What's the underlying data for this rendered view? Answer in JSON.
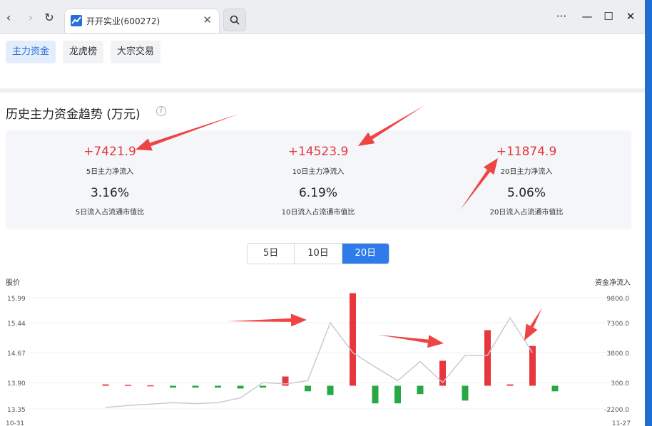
{
  "browser": {
    "tab_title": "开开实业(600272)",
    "back_glyph": "‹",
    "forward_glyph": "›",
    "reload_glyph": "↻",
    "close_glyph": "✕",
    "menu_glyph": "···",
    "minimize_glyph": "—",
    "maximize_glyph": "☐",
    "window_close_glyph": "✕"
  },
  "subtabs": [
    {
      "label": "主力资金",
      "active": true
    },
    {
      "label": "龙虎榜",
      "active": false
    },
    {
      "label": "大宗交易",
      "active": false
    }
  ],
  "section": {
    "title": "历史主力资金趋势 (万元)",
    "info_glyph": "i"
  },
  "stats": [
    {
      "value": "+7421.9",
      "label": "5日主力净流入",
      "pct": "3.16%",
      "pct_label": "5日流入占流通市值比"
    },
    {
      "value": "+14523.9",
      "label": "10日主力净流入",
      "pct": "6.19%",
      "pct_label": "10日流入占流通市值比"
    },
    {
      "value": "+11874.9",
      "label": "20日主力净流入",
      "pct": "5.06%",
      "pct_label": "20日流入占流通市值比"
    }
  ],
  "range_buttons": [
    {
      "label": "5日",
      "active": false
    },
    {
      "label": "10日",
      "active": false
    },
    {
      "label": "20日",
      "active": true
    }
  ],
  "colors": {
    "inflow": "#e8363d",
    "outflow": "#27a844",
    "price_line": "#c8cbd0",
    "accent": "#2f7bea",
    "annotation_arrow": "#ee4444"
  },
  "chart_data": {
    "type": "bar",
    "left_axis_title": "股价",
    "right_axis_title": "资金净流入",
    "left_ticks": [
      "15.99",
      "15.44",
      "14.67",
      "13.90",
      "13.35"
    ],
    "right_ticks": [
      "9800.0",
      "7300.0",
      "3800.0",
      "300.0",
      "-2200.0"
    ],
    "x_start_label": "10-31",
    "x_end_label": "11-27",
    "ylim_right": [
      -2200,
      9800
    ],
    "series": [
      {
        "name": "资金净流入",
        "values": [
          150,
          100,
          50,
          -200,
          -200,
          -200,
          -300,
          -200,
          1000,
          -600,
          -1000,
          10000,
          -1900,
          -1900,
          -900,
          2700,
          -1600,
          6000,
          150,
          4300,
          -600
        ]
      },
      {
        "name": "股价",
        "values": [
          13.38,
          13.42,
          13.45,
          13.48,
          13.46,
          13.48,
          13.58,
          13.9,
          13.87,
          13.95,
          15.44,
          14.67,
          14.3,
          13.95,
          14.44,
          13.9,
          14.6,
          14.6,
          15.55,
          14.67
        ]
      }
    ]
  }
}
